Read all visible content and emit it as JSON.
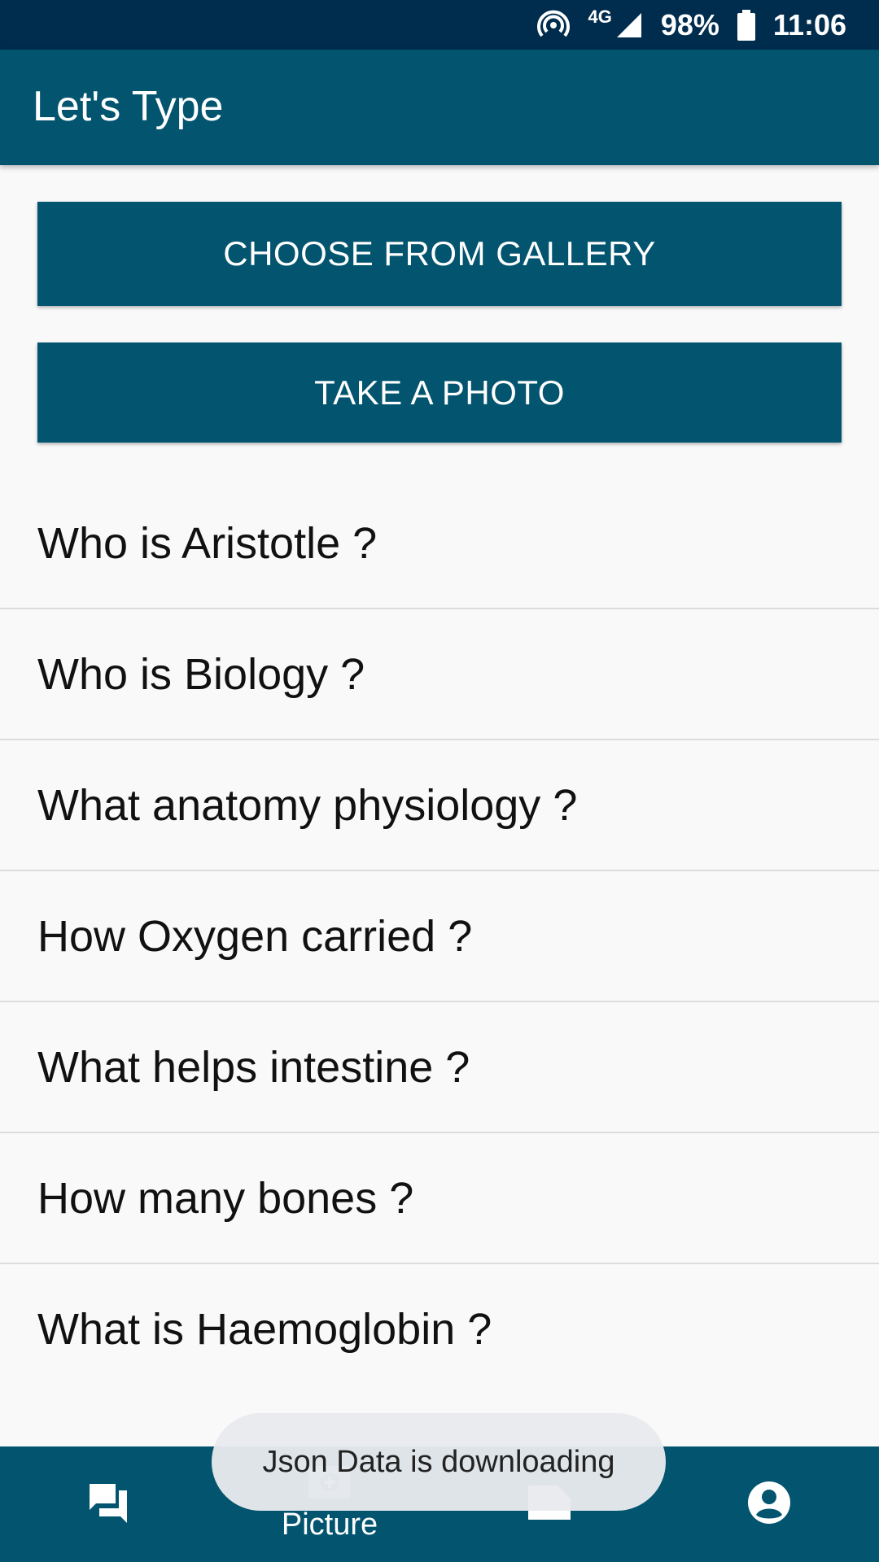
{
  "status_bar": {
    "network": "4G",
    "battery": "98%",
    "time": "11:06"
  },
  "app_bar": {
    "title": "Let's Type"
  },
  "actions": {
    "gallery_label": "CHOOSE FROM GALLERY",
    "photo_label": "TAKE A PHOTO"
  },
  "questions": [
    "Who is Aristotle ?",
    "Who is Biology ?",
    "What anatomy physiology ?",
    "How Oxygen carried ?",
    "What helps intestine ?",
    "How many bones ?",
    "What is Haemoglobin ?"
  ],
  "bottom_nav": {
    "items": [
      {
        "icon": "chat-icon",
        "label": ""
      },
      {
        "icon": "add-picture-icon",
        "label": "Picture"
      },
      {
        "icon": "document-icon",
        "label": ""
      },
      {
        "icon": "account-icon",
        "label": ""
      }
    ]
  },
  "toast": {
    "message": "Json Data is downloading"
  },
  "colors": {
    "primary": "#02546f",
    "status_bar": "#002c4e",
    "background": "#f9f9f9"
  }
}
